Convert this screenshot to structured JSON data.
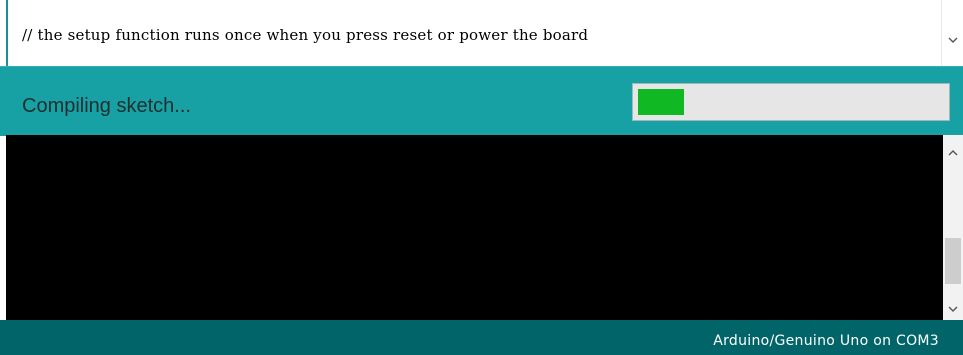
{
  "editor": {
    "code_line": "// the setup function runs once when you press reset or power the board",
    "scroll_down_icon": "chevron-down"
  },
  "status": {
    "message": "Compiling sketch...",
    "progress_fraction": 0.15,
    "progress_color": "#10b823",
    "bar_color": "#17a1a5"
  },
  "console": {
    "background": "#000000",
    "scroll_up_icon": "chevron-up",
    "scroll_down_icon": "chevron-down"
  },
  "footer": {
    "board_info": "Arduino/Genuino Uno on COM3",
    "background": "#006468"
  }
}
